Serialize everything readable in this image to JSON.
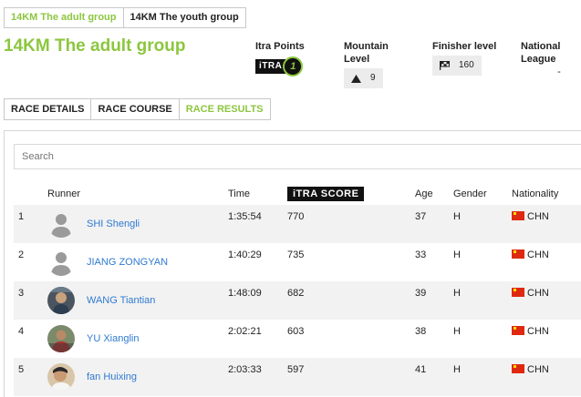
{
  "group_tabs": [
    {
      "label": "14KM The adult group",
      "active": true
    },
    {
      "label": "14KM The youth group",
      "active": false
    }
  ],
  "race_title": "14KM The adult group",
  "stats": {
    "itra_points": {
      "label": "Itra Points",
      "logo_text": "iTRA",
      "value": "1"
    },
    "mountain_level": {
      "label": "Mountain Level",
      "value": "9",
      "icon": "mountain-icon"
    },
    "finisher_level": {
      "label": "Finisher level",
      "value": "160",
      "icon": "flag-icon"
    },
    "national_league": {
      "label": "National League",
      "value": "-"
    }
  },
  "race_tabs": [
    {
      "label": "RACE DETAILS",
      "active": false
    },
    {
      "label": "RACE COURSE",
      "active": false
    },
    {
      "label": "RACE RESULTS",
      "active": true
    }
  ],
  "search": {
    "placeholder": "Search"
  },
  "table": {
    "headers": {
      "rank": "",
      "runner": "Runner",
      "time": "Time",
      "score": "iTRA SCORE",
      "age": "Age",
      "gender": "Gender",
      "nationality": "Nationality"
    },
    "rows": [
      {
        "rank": "1",
        "runner": "SHI Shengli",
        "time": "1:35:54",
        "score": "770",
        "age": "37",
        "gender": "H",
        "nationality": "CHN",
        "avatar": "placeholder"
      },
      {
        "rank": "2",
        "runner": "JIANG ZONGYAN",
        "time": "1:40:29",
        "score": "735",
        "age": "33",
        "gender": "H",
        "nationality": "CHN",
        "avatar": "placeholder"
      },
      {
        "rank": "3",
        "runner": "WANG Tiantian",
        "time": "1:48:09",
        "score": "682",
        "age": "39",
        "gender": "H",
        "nationality": "CHN",
        "avatar": "photo"
      },
      {
        "rank": "4",
        "runner": "YU Xianglin",
        "time": "2:02:21",
        "score": "603",
        "age": "38",
        "gender": "H",
        "nationality": "CHN",
        "avatar": "photo"
      },
      {
        "rank": "5",
        "runner": "fan Huixing",
        "time": "2:03:33",
        "score": "597",
        "age": "41",
        "gender": "H",
        "nationality": "CHN",
        "avatar": "photo"
      }
    ]
  },
  "colors": {
    "accent": "#8cc63f",
    "link": "#2f7ad1",
    "row_alt": "#f2f2f2"
  }
}
